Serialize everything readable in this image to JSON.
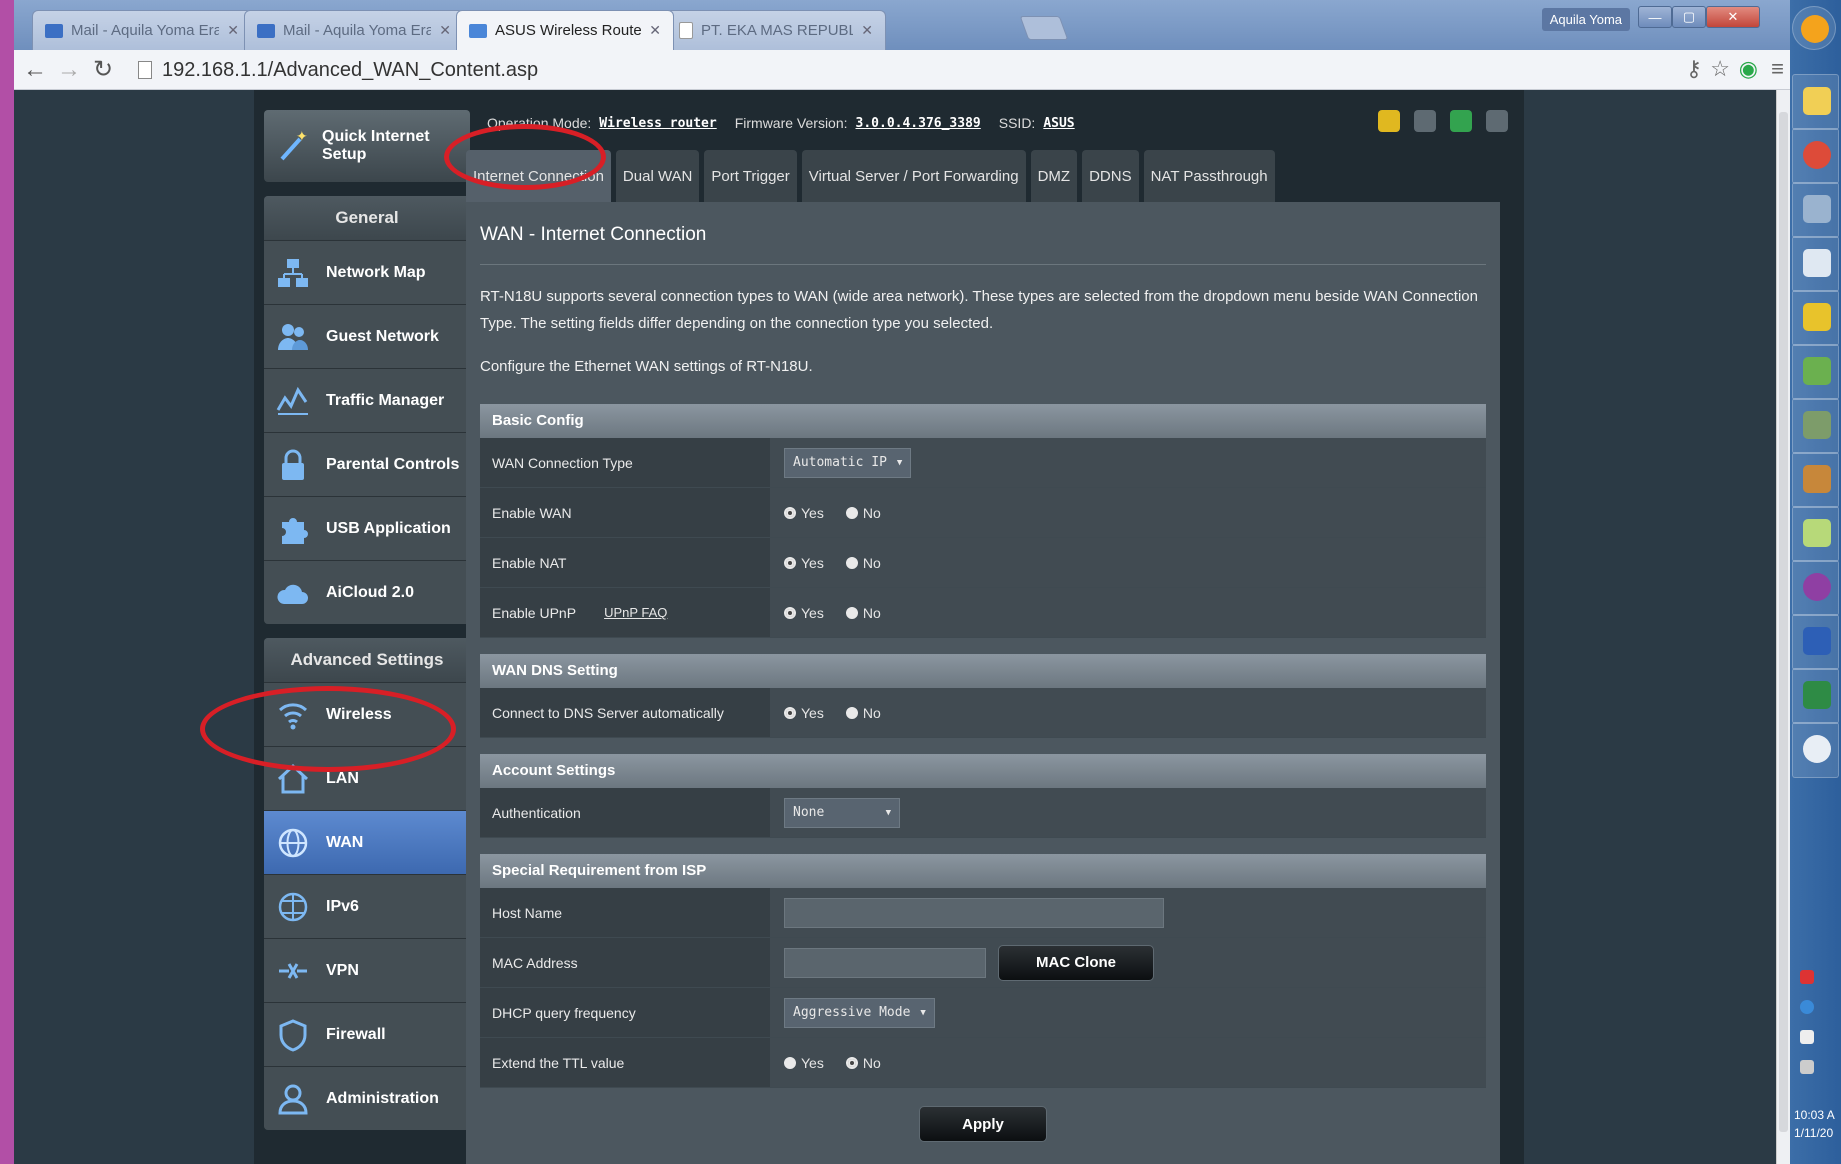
{
  "browser": {
    "tabs": [
      {
        "label": "Mail - Aquila Yoma Erady",
        "active": false
      },
      {
        "label": "Mail - Aquila Yoma Erady",
        "active": false
      },
      {
        "label": "ASUS Wireless Router RT-",
        "active": true
      },
      {
        "label": "PT. EKA MAS REPUBLIK",
        "active": false
      }
    ],
    "user": "Aquila Yoma",
    "url": "192.168.1.1/Advanced_WAN_Content.asp"
  },
  "status": {
    "op_mode_label": "Operation Mode:",
    "op_mode": "Wireless router",
    "fw_label": "Firmware Version:",
    "fw": "3.0.0.4.376_3389",
    "ssid_label": "SSID:",
    "ssid": "ASUS"
  },
  "sidebar": {
    "quick_setup": "Quick Internet Setup",
    "general_title": "General",
    "general": [
      {
        "label": "Network Map",
        "icon": "network-map-icon"
      },
      {
        "label": "Guest Network",
        "icon": "guest-network-icon"
      },
      {
        "label": "Traffic Manager",
        "icon": "traffic-manager-icon"
      },
      {
        "label": "Parental Controls",
        "icon": "lock-icon"
      },
      {
        "label": "USB Application",
        "icon": "puzzle-icon"
      },
      {
        "label": "AiCloud 2.0",
        "icon": "cloud-icon"
      }
    ],
    "advanced_title": "Advanced Settings",
    "advanced": [
      {
        "label": "Wireless",
        "icon": "wifi-icon"
      },
      {
        "label": "LAN",
        "icon": "home-icon"
      },
      {
        "label": "WAN",
        "icon": "globe-icon",
        "active": true
      },
      {
        "label": "IPv6",
        "icon": "ipv6-globe-icon"
      },
      {
        "label": "VPN",
        "icon": "vpn-icon"
      },
      {
        "label": "Firewall",
        "icon": "shield-icon"
      },
      {
        "label": "Administration",
        "icon": "user-icon"
      }
    ]
  },
  "tabs": [
    "Internet Connection",
    "Dual WAN",
    "Port Trigger",
    "Virtual Server / Port Forwarding",
    "DMZ",
    "DDNS",
    "NAT Passthrough"
  ],
  "content": {
    "title": "WAN - Internet Connection",
    "desc": "RT-N18U supports several connection types to WAN (wide area network). These types are selected from the dropdown menu beside WAN Connection Type. The setting fields differ depending on the connection type you selected.",
    "config_line": "Configure the Ethernet WAN settings of RT-N18U.",
    "yes": "Yes",
    "no": "No",
    "basic": {
      "title": "Basic Config",
      "wan_type_label": "WAN Connection Type",
      "wan_type_value": "Automatic IP",
      "enable_wan_label": "Enable WAN",
      "enable_nat_label": "Enable NAT",
      "enable_upnp_label": "Enable UPnP",
      "upnp_faq": "UPnP  FAQ"
    },
    "dns": {
      "title": "WAN DNS Setting",
      "auto_label": "Connect to DNS Server automatically"
    },
    "account": {
      "title": "Account Settings",
      "auth_label": "Authentication",
      "auth_value": "None"
    },
    "isp": {
      "title": "Special Requirement from ISP",
      "host_label": "Host Name",
      "host_value": "",
      "mac_label": "MAC Address",
      "mac_value": "",
      "mac_clone": "MAC Clone",
      "dhcp_label": "DHCP query frequency",
      "dhcp_value": "Aggressive Mode",
      "ttl_label": "Extend the TTL value"
    },
    "apply": "Apply"
  },
  "taskbar": {
    "time": "10:03 A",
    "date": "1/11/20"
  }
}
